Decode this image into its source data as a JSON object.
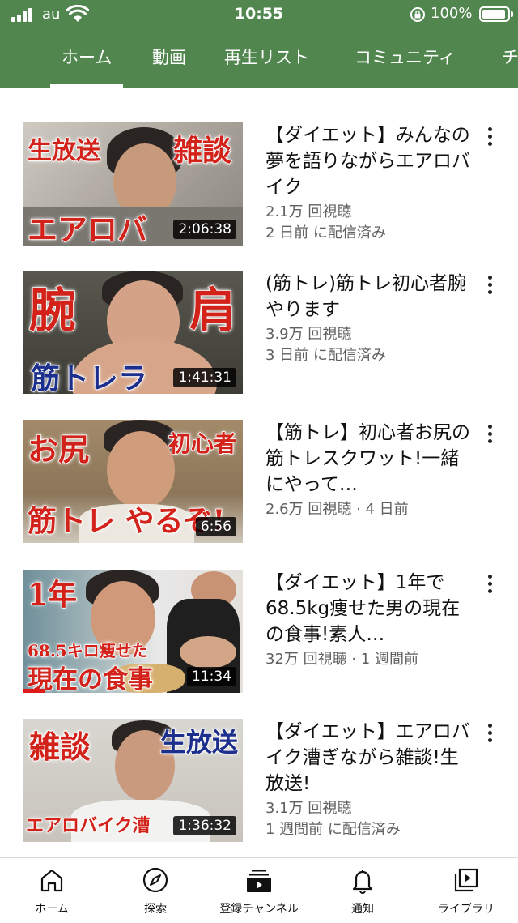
{
  "status_bar": {
    "carrier": "au",
    "time": "10:55",
    "battery": "100%"
  },
  "tabs": [
    {
      "label": "ホーム",
      "active": true
    },
    {
      "label": "動画"
    },
    {
      "label": "再生リスト"
    },
    {
      "label": "コミュニティ"
    },
    {
      "label": "チ"
    }
  ],
  "videos": [
    {
      "title": "【ダイエット】みんなの夢を語りながらエアロバイク",
      "views": "2.1万 回視聴",
      "date": "2 日前 に配信済み",
      "duration": "2:06:38",
      "overlay": [
        "生放送",
        "雑談",
        "エアロバ"
      ]
    },
    {
      "title": "(筋トレ)筋トレ初心者腕やります",
      "views": "3.9万 回視聴",
      "date": "3 日前 に配信済み",
      "duration": "1:41:31",
      "overlay": [
        "腕",
        "肩",
        "筋トレラ"
      ]
    },
    {
      "title": "【筋トレ】初心者お尻の筋トレスクワット!一緒にやって…",
      "meta": "2.6万 回視聴 · 4 日前",
      "duration": "6:56",
      "overlay": [
        "お尻",
        "初心者",
        "筋トレ やるぞ!"
      ]
    },
    {
      "title": "【ダイエット】1年で68.5kg痩せた男の現在の食事!素人…",
      "meta": "32万 回視聴 · 1 週間前",
      "duration": "11:34",
      "overlay": [
        "1年",
        "68.5キロ痩せた",
        "現在の食事"
      ]
    },
    {
      "title": "【ダイエット】エアロバイク漕ぎながら雑談!生放送!",
      "views": "3.1万 回視聴",
      "date": "1 週間前 に配信済み",
      "duration": "1:36:32",
      "overlay": [
        "雑談",
        "生放送",
        "エアロバイク漕"
      ]
    }
  ],
  "bottom_nav": [
    {
      "label": "ホーム",
      "icon": "home-icon"
    },
    {
      "label": "探索",
      "icon": "compass-icon"
    },
    {
      "label": "登録チャンネル",
      "icon": "subscriptions-icon"
    },
    {
      "label": "通知",
      "icon": "bell-icon"
    },
    {
      "label": "ライブラリ",
      "icon": "library-icon"
    }
  ],
  "colors": {
    "header": "#52864f",
    "overlay_red": "#d2221a",
    "overlay_blue": "#1d2f8c",
    "progress": "#e01b1b"
  }
}
